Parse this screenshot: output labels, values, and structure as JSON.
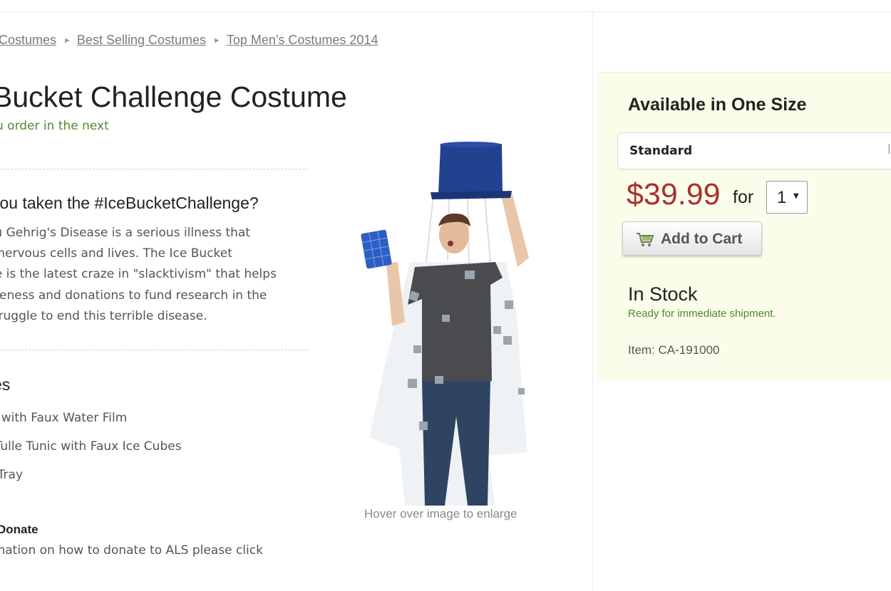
{
  "breadcrumb": {
    "items": [
      "Costumes",
      "Best Selling Costumes",
      "Top Men's Costumes 2014"
    ],
    "separator": "►"
  },
  "product": {
    "title": "Bucket Challenge Costume",
    "order_note": "u order in the next",
    "question_heading": "you taken the #IceBucketChallenge?",
    "description_lines": [
      "ou Gehrig's Disease is a serious illness that",
      "s nervous cells and lives. The Ice Bucket",
      "ge is the latest craze in \"slacktivism\" that helps",
      "areness and donations to fund research in the",
      "struggle to end this terrible disease."
    ],
    "includes_heading": "es",
    "includes_items": [
      "ket with Faux Water Film",
      "te Tulle Tunic with Faux Ice Cubes",
      "be Tray"
    ],
    "donate_heading": "Donate",
    "donate_text": "rmation on how to donate to ALS please click",
    "image_hint": "Hover over image to enlarge"
  },
  "buybox": {
    "size_heading": "Available in One Size",
    "size_option": "Standard",
    "price": "$39.99",
    "for_label": "for",
    "quantity": "1",
    "add_to_cart": "Add to Cart",
    "stock_status": "In Stock",
    "shipment_note": "Ready for immediate shipment.",
    "item_number": "Item: CA-191000"
  },
  "colors": {
    "price": "#a8312f",
    "green_text": "#4f8a2e",
    "buybox_bg": "#fcfcea",
    "bucket_blue": "#1f3f8f"
  },
  "icons": [
    "cart-icon",
    "dropdown-caret-icon"
  ]
}
